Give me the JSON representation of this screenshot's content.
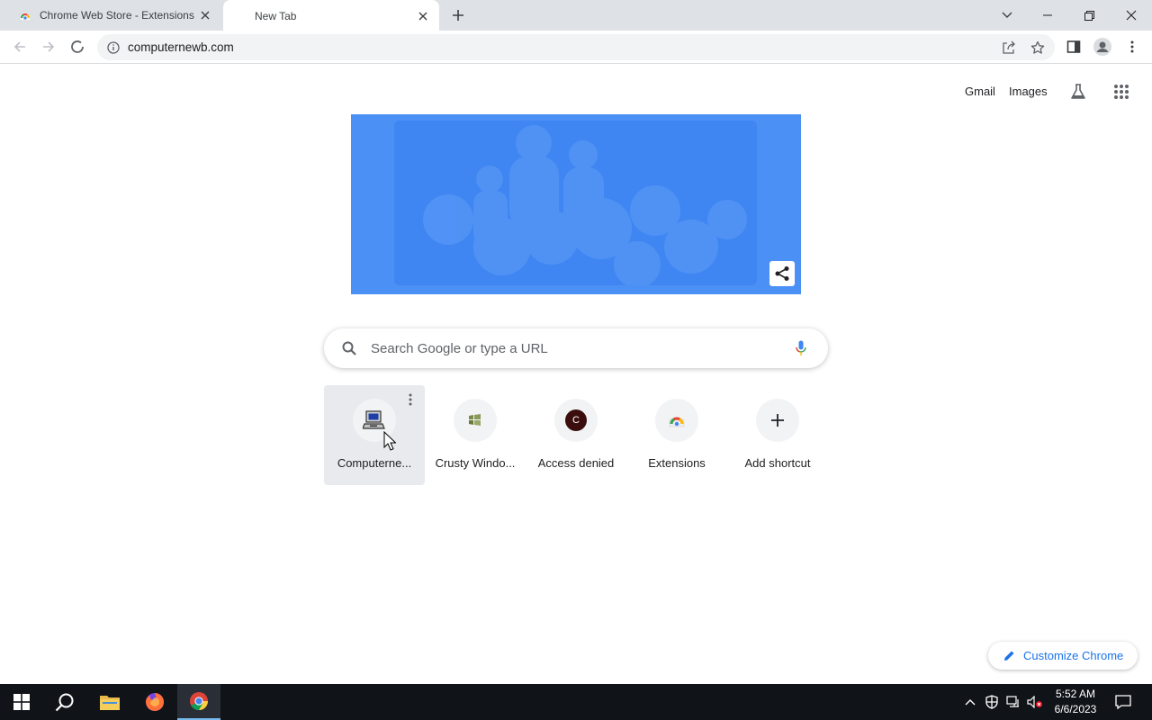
{
  "tabs": [
    {
      "title": "Chrome Web Store - Extensions",
      "active": false
    },
    {
      "title": "New Tab",
      "active": true
    }
  ],
  "address_bar": {
    "url": "computernewb.com"
  },
  "top_links": {
    "gmail": "Gmail",
    "images": "Images"
  },
  "search": {
    "placeholder": "Search Google or type a URL"
  },
  "shortcuts": [
    {
      "label": "Computerne...",
      "icon": "computer-icon"
    },
    {
      "label": "Crusty Windo...",
      "icon": "crusty-windows-icon"
    },
    {
      "label": "Access denied",
      "icon": "letter-c-icon",
      "letter": "C"
    },
    {
      "label": "Extensions",
      "icon": "chrome-web-store-icon"
    },
    {
      "label": "Add shortcut",
      "icon": "plus-icon"
    }
  ],
  "customize": {
    "label": "Customize Chrome"
  },
  "taskbar": {
    "time": "5:52 AM",
    "date": "6/6/2023"
  },
  "colors": {
    "accent": "#1a73e8",
    "doodle": "#4a90f5",
    "tabstrip": "#dee1e6",
    "taskbar": "#101318"
  }
}
